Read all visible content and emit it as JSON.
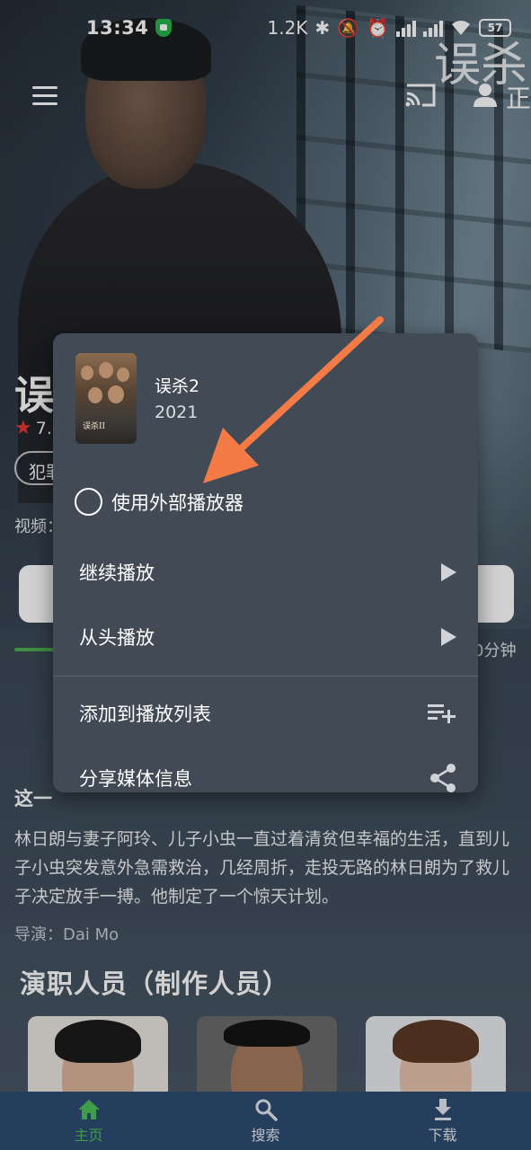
{
  "status_bar": {
    "time": "13:34",
    "net_speed": "1.2K",
    "battery": "57"
  },
  "background": {
    "title_char": "误杀"
  },
  "app_bar": {
    "extra_glyph": "正"
  },
  "details": {
    "title_peek": "误",
    "rating_peek": "7.",
    "genre_peek": "犯罪",
    "video_label_peek": "视频：",
    "duration_peek": "0分钟",
    "summary_heading_peek": "这一",
    "description": "林日朗与妻子阿玲、儿子小虫一直过着清贫但幸福的生活，直到儿子小虫突发意外急需救治，几经周折，走投无路的林日朗为了救儿子决定放手一搏。他制定了一个惊天计划。",
    "director": "导演：Dai Mo",
    "cast_heading": "演职人员（制作人员）"
  },
  "popup": {
    "title": "误杀2",
    "year": "2021",
    "poster_text": "误杀II",
    "external_player_label": "使用外部播放器",
    "external_player_checked": false,
    "items": [
      {
        "label": "继续播放",
        "icon": "play-icon"
      },
      {
        "label": "从头播放",
        "icon": "play-icon"
      },
      {
        "label": "添加到播放列表",
        "icon": "playlist-add-icon"
      },
      {
        "label": "分享媒体信息",
        "icon": "share-icon"
      }
    ]
  },
  "bottom_nav": {
    "items": [
      {
        "label": "主页",
        "icon": "home-icon",
        "active": true
      },
      {
        "label": "搜索",
        "icon": "search-icon",
        "active": false
      },
      {
        "label": "下载",
        "icon": "download-icon",
        "active": false
      }
    ]
  },
  "colors": {
    "accent": "#4cc05a",
    "annotation_arrow": "#f47b45",
    "popup_bg": "#424b55",
    "bottom_nav_bg": "#2e4c72"
  }
}
